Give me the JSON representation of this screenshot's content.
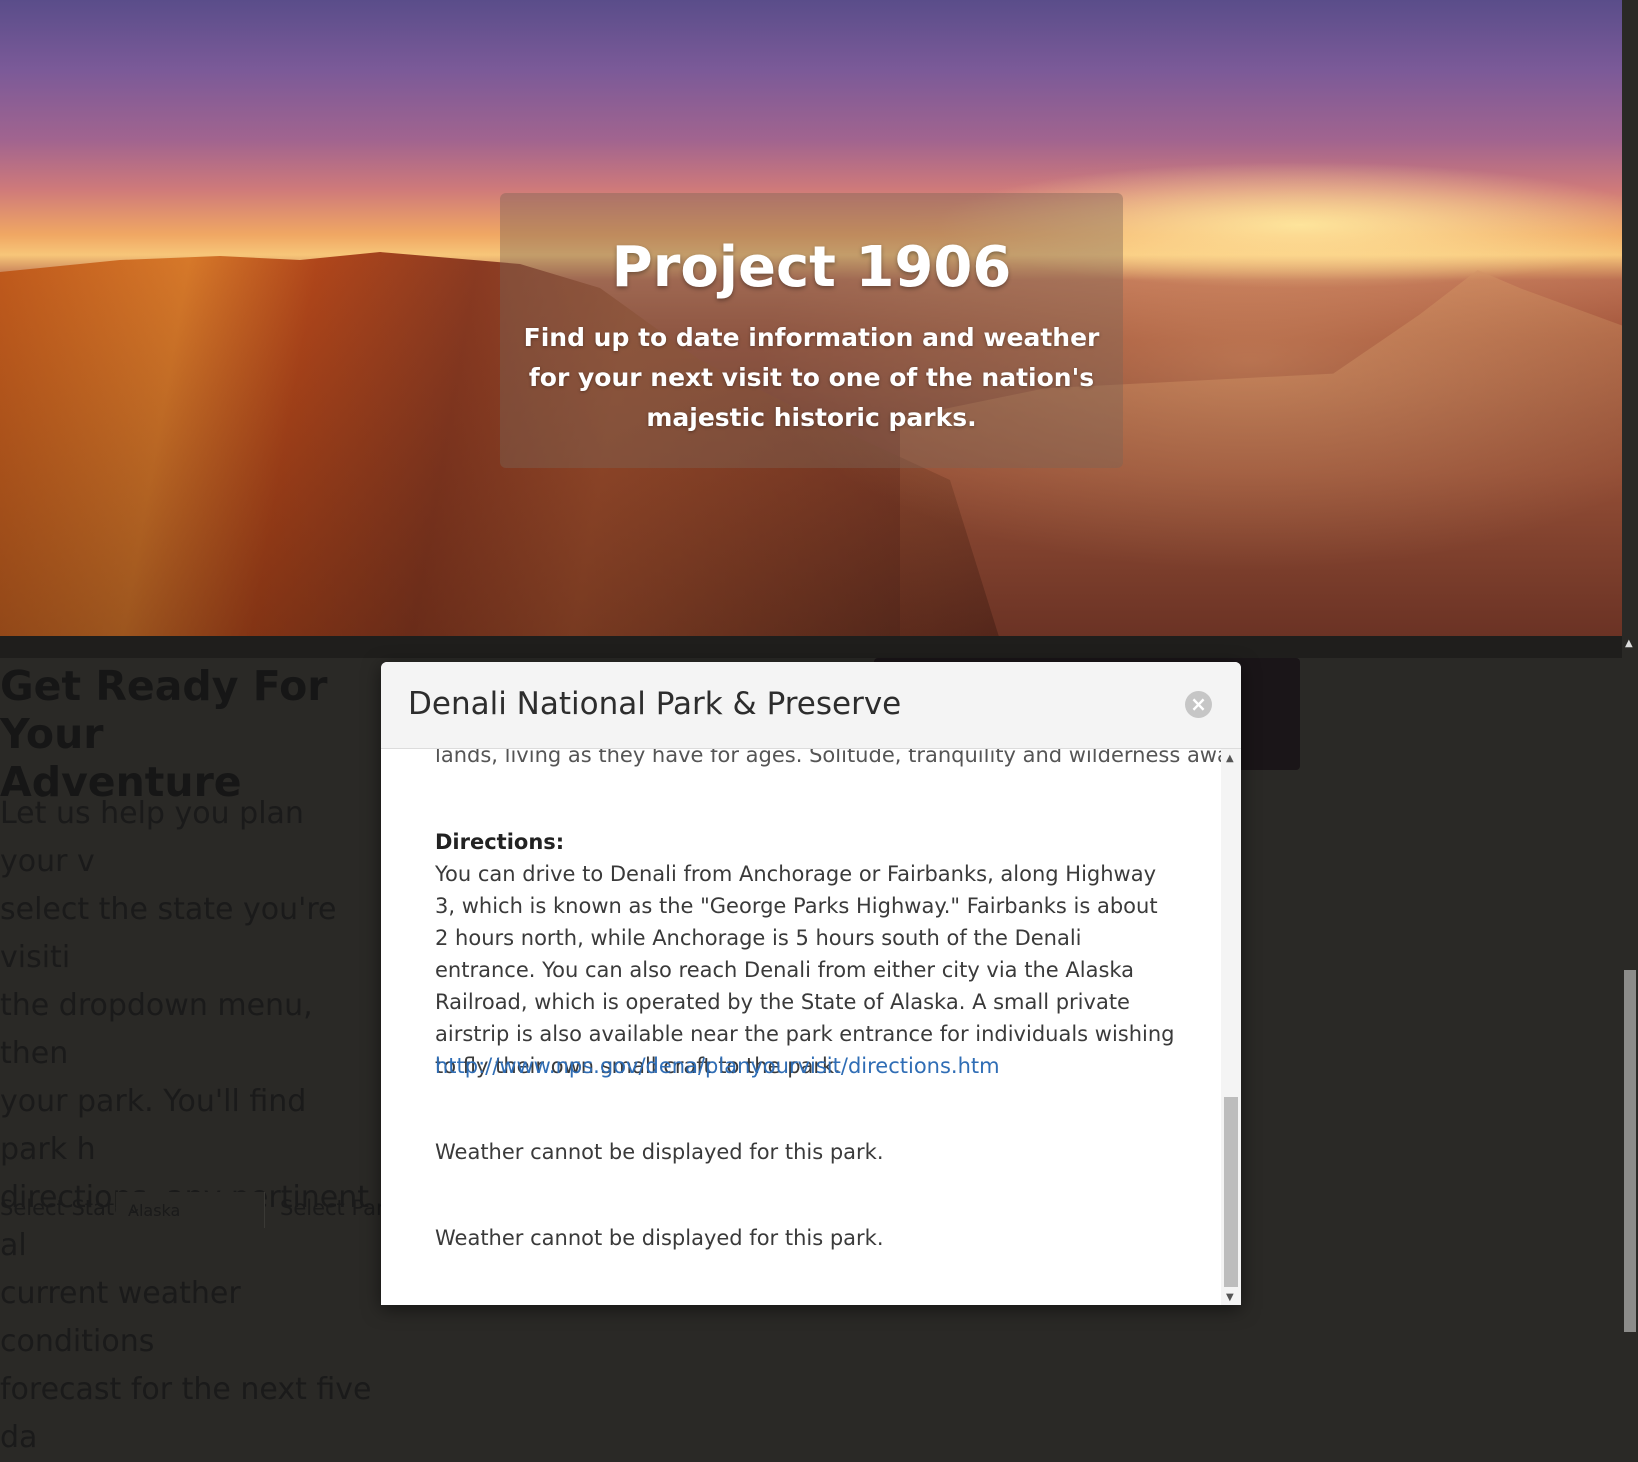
{
  "hero": {
    "title": "Project 1906",
    "subtitle": "Find up to date information and weather for your next visit to one of the nation's majestic historic parks."
  },
  "intro": {
    "heading": "Get Ready For Your\nAdventure",
    "text": "Let us help you plan your v\nselect the state you're visiti\nthe dropdown menu, then \nyour park. You'll find park h\ndirections, any pertinent al\ncurrent weather conditions\nforecast for the next five da"
  },
  "selectors": {
    "state_label": "Select State",
    "state_value": "Alaska",
    "park_label": "Select Park"
  },
  "modal": {
    "title": "Denali National Park & Preserve",
    "close_icon": "close-icon",
    "cut_line": "lands, living as they have for ages. Solitude, tranquility and wilderness await.",
    "directions_heading": "Directions:",
    "directions_text": "You can drive to Denali from Anchorage or Fairbanks, along Highway 3, which is known as the \"George Parks Highway.\" Fairbanks is about 2 hours north, while Anchorage is 5 hours south of the Denali entrance. You can also reach Denali from either city via the Alaska Railroad, which is operated by the State of Alaska. A small private airstrip is also available near the park entrance for individuals wishing to fly their own small craft to the park.",
    "directions_link": "http://www.nps.gov/dena/planyourvisit/directions.htm",
    "weather_message_1": "Weather cannot be displayed for this park.",
    "weather_message_2": "Weather cannot be displayed for this park."
  }
}
